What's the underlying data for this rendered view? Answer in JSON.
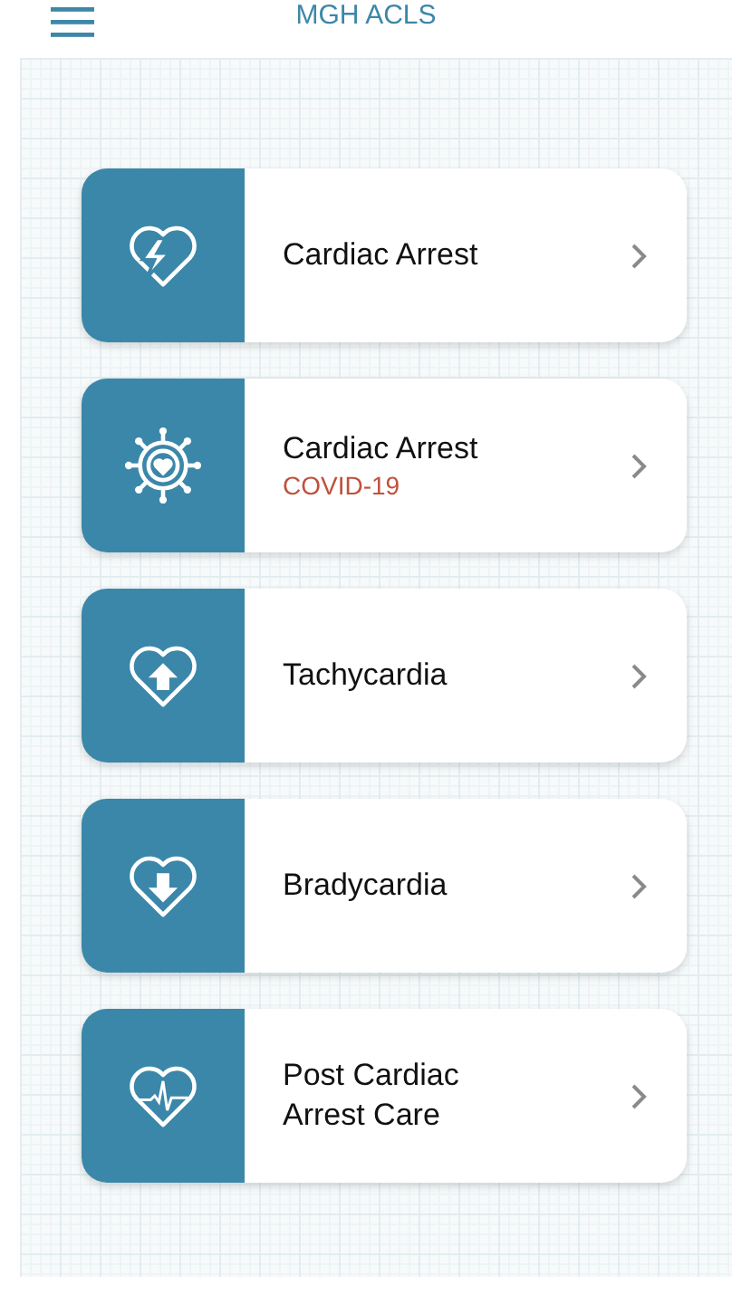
{
  "header": {
    "title": "MGH ACLS"
  },
  "cards": [
    {
      "kind": "shock",
      "title": "Cardiac Arrest"
    },
    {
      "kind": "virus",
      "title": "Cardiac Arrest",
      "subtitle": "COVID-19"
    },
    {
      "kind": "up",
      "title": "Tachycardia"
    },
    {
      "kind": "down",
      "title": "Bradycardia"
    },
    {
      "kind": "ecg",
      "title": "Post Cardiac Arrest Care"
    }
  ]
}
